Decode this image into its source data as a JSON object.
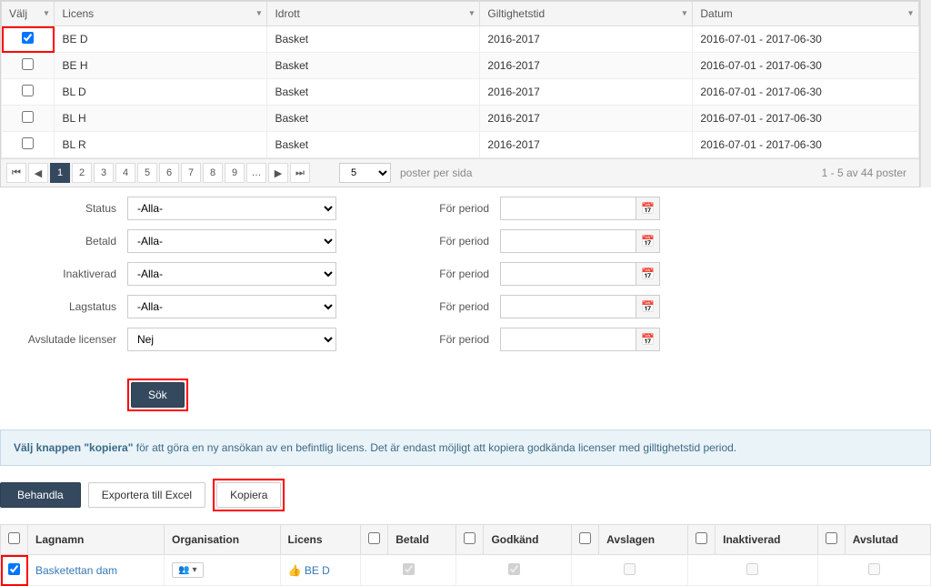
{
  "topTable": {
    "headers": {
      "valj": "Välj",
      "licens": "Licens",
      "idrott": "Idrott",
      "gilt": "Giltighetstid",
      "datum": "Datum"
    },
    "rows": [
      {
        "checked": true,
        "licens": "BE D",
        "idrott": "Basket",
        "gilt": "2016-2017",
        "datum": "2016-07-01 - 2017-06-30"
      },
      {
        "checked": false,
        "licens": "BE H",
        "idrott": "Basket",
        "gilt": "2016-2017",
        "datum": "2016-07-01 - 2017-06-30"
      },
      {
        "checked": false,
        "licens": "BL D",
        "idrott": "Basket",
        "gilt": "2016-2017",
        "datum": "2016-07-01 - 2017-06-30"
      },
      {
        "checked": false,
        "licens": "BL H",
        "idrott": "Basket",
        "gilt": "2016-2017",
        "datum": "2016-07-01 - 2017-06-30"
      },
      {
        "checked": false,
        "licens": "BL R",
        "idrott": "Basket",
        "gilt": "2016-2017",
        "datum": "2016-07-01 - 2017-06-30"
      }
    ]
  },
  "pager": {
    "pages": [
      "1",
      "2",
      "3",
      "4",
      "5",
      "6",
      "7",
      "8",
      "9"
    ],
    "active": "1",
    "pageSize": "5",
    "perPageLabel": "poster per sida",
    "info": "1 - 5 av 44 poster"
  },
  "filters": {
    "labels": {
      "status": "Status",
      "betald": "Betald",
      "inaktiverad": "Inaktiverad",
      "lagstatus": "Lagstatus",
      "avslutade": "Avslutade licenser",
      "period": "För period"
    },
    "values": {
      "alla": "-Alla-",
      "nej": "Nej"
    }
  },
  "sok": "Sök",
  "infoBar": {
    "bold": "Välj knappen \"kopiera\"",
    "rest": " för att göra en ny ansökan av en befintlig licens. Det är endast möjligt att kopiera godkända licenser med gilltighetstid period."
  },
  "actions": {
    "behandla": "Behandla",
    "export": "Exportera till Excel",
    "kopiera": "Kopiera"
  },
  "bottomTable": {
    "headers": {
      "lagnamn": "Lagnamn",
      "organisation": "Organisation",
      "licens": "Licens",
      "betald": "Betald",
      "godkand": "Godkänd",
      "avslagen": "Avslagen",
      "inaktiverad": "Inaktiverad",
      "avslutad": "Avslutad"
    },
    "row": {
      "lagnamn": "Basketettan dam",
      "licens": "BE D"
    }
  }
}
